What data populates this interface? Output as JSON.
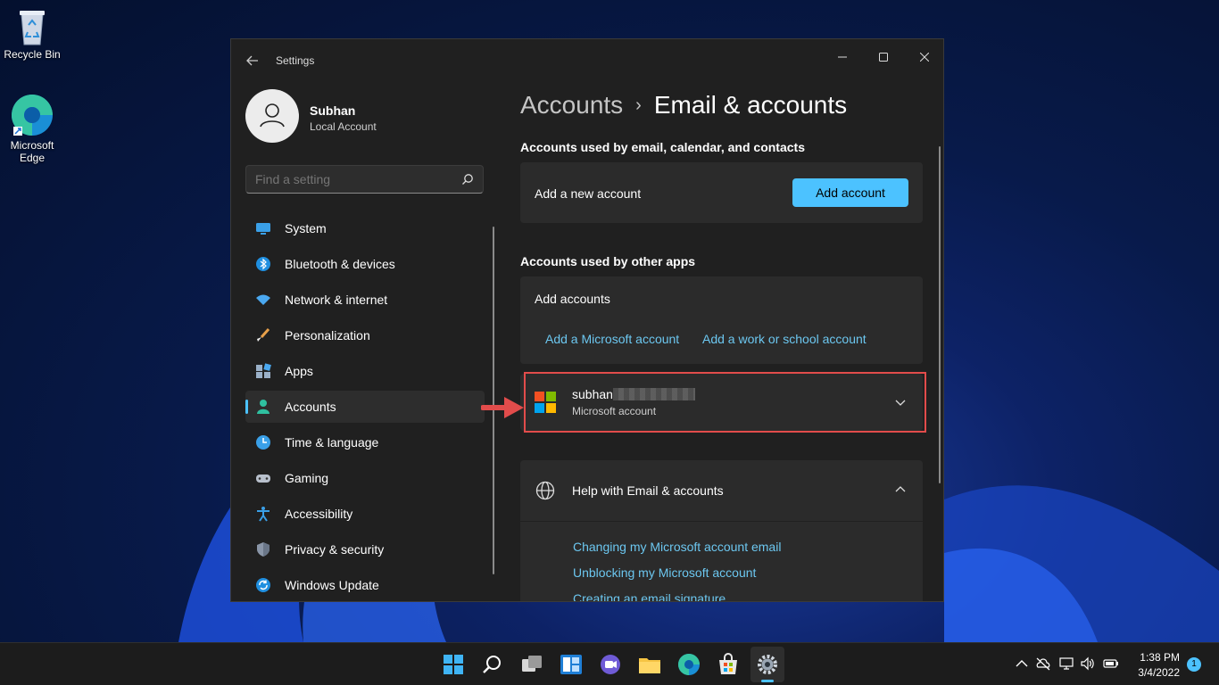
{
  "desktop": {
    "icons": [
      {
        "label": "Recycle Bin"
      },
      {
        "label": "Microsoft Edge"
      }
    ]
  },
  "window": {
    "title": "Settings",
    "controls": {
      "minimize": "—",
      "maximize": "☐",
      "close": "✕"
    }
  },
  "profile": {
    "name": "Subhan",
    "account_type": "Local Account"
  },
  "search": {
    "placeholder": "Find a setting"
  },
  "nav": {
    "items": [
      {
        "label": "System",
        "icon": "system-icon"
      },
      {
        "label": "Bluetooth & devices",
        "icon": "bluetooth-icon"
      },
      {
        "label": "Network & internet",
        "icon": "network-icon"
      },
      {
        "label": "Personalization",
        "icon": "brush-icon"
      },
      {
        "label": "Apps",
        "icon": "apps-icon"
      },
      {
        "label": "Accounts",
        "icon": "accounts-icon",
        "active": true
      },
      {
        "label": "Time & language",
        "icon": "clock-icon"
      },
      {
        "label": "Gaming",
        "icon": "gamepad-icon"
      },
      {
        "label": "Accessibility",
        "icon": "accessibility-icon"
      },
      {
        "label": "Privacy & security",
        "icon": "shield-icon"
      },
      {
        "label": "Windows Update",
        "icon": "update-icon"
      }
    ]
  },
  "breadcrumb": {
    "parent": "Accounts",
    "separator": "›",
    "current": "Email & accounts"
  },
  "email_section": {
    "heading": "Accounts used by email, calendar, and contacts",
    "add_new_label": "Add a new account",
    "add_button": "Add account"
  },
  "other_apps_section": {
    "heading": "Accounts used by other apps",
    "add_accounts_label": "Add accounts",
    "link_microsoft": "Add a Microsoft account",
    "link_work": "Add a work or school account"
  },
  "account_entry": {
    "username": "subhan",
    "type": "Microsoft account"
  },
  "help": {
    "title": "Help with Email & accounts",
    "links": [
      "Changing my Microsoft account email",
      "Unblocking my Microsoft account",
      "Creating an email signature"
    ]
  },
  "taskbar": {
    "time": "1:38 PM",
    "date": "3/4/2022",
    "notifications": "1"
  },
  "colors": {
    "accent": "#4cc2ff",
    "window_bg": "#202020",
    "card_bg": "#2b2b2b",
    "link": "#6cc7f0",
    "highlight": "#e24c4b"
  }
}
